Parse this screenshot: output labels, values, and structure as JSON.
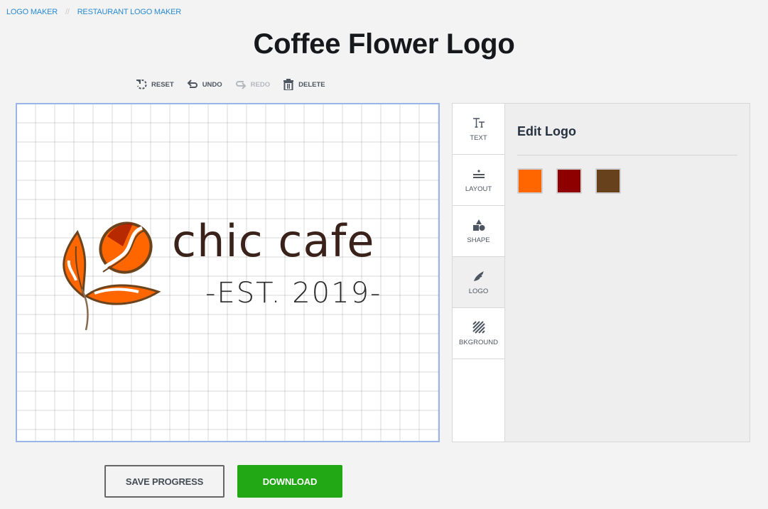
{
  "breadcrumb": {
    "items": [
      "LOGO MAKER",
      "RESTAURANT LOGO MAKER"
    ],
    "separator": "//"
  },
  "page": {
    "title": "Coffee Flower Logo"
  },
  "toolbar": {
    "reset": "RESET",
    "undo": "UNDO",
    "redo": "REDO",
    "delete": "DELETE"
  },
  "canvas": {
    "logo_name": "chic cafe",
    "tagline": "-EST. 2019-"
  },
  "side_tabs": [
    {
      "label": "TEXT",
      "icon": "text-size-icon"
    },
    {
      "label": "LAYOUT",
      "icon": "layout-icon"
    },
    {
      "label": "SHAPE",
      "icon": "shapes-icon"
    },
    {
      "label": "LOGO",
      "icon": "logo-icon",
      "active": true
    },
    {
      "label": "BKGROUND",
      "icon": "background-icon"
    }
  ],
  "edit_panel": {
    "title": "Edit Logo",
    "colors": [
      "#ff6600",
      "#8e0000",
      "#66411c"
    ]
  },
  "actions": {
    "save": "SAVE PROGRESS",
    "download": "DOWNLOAD"
  }
}
